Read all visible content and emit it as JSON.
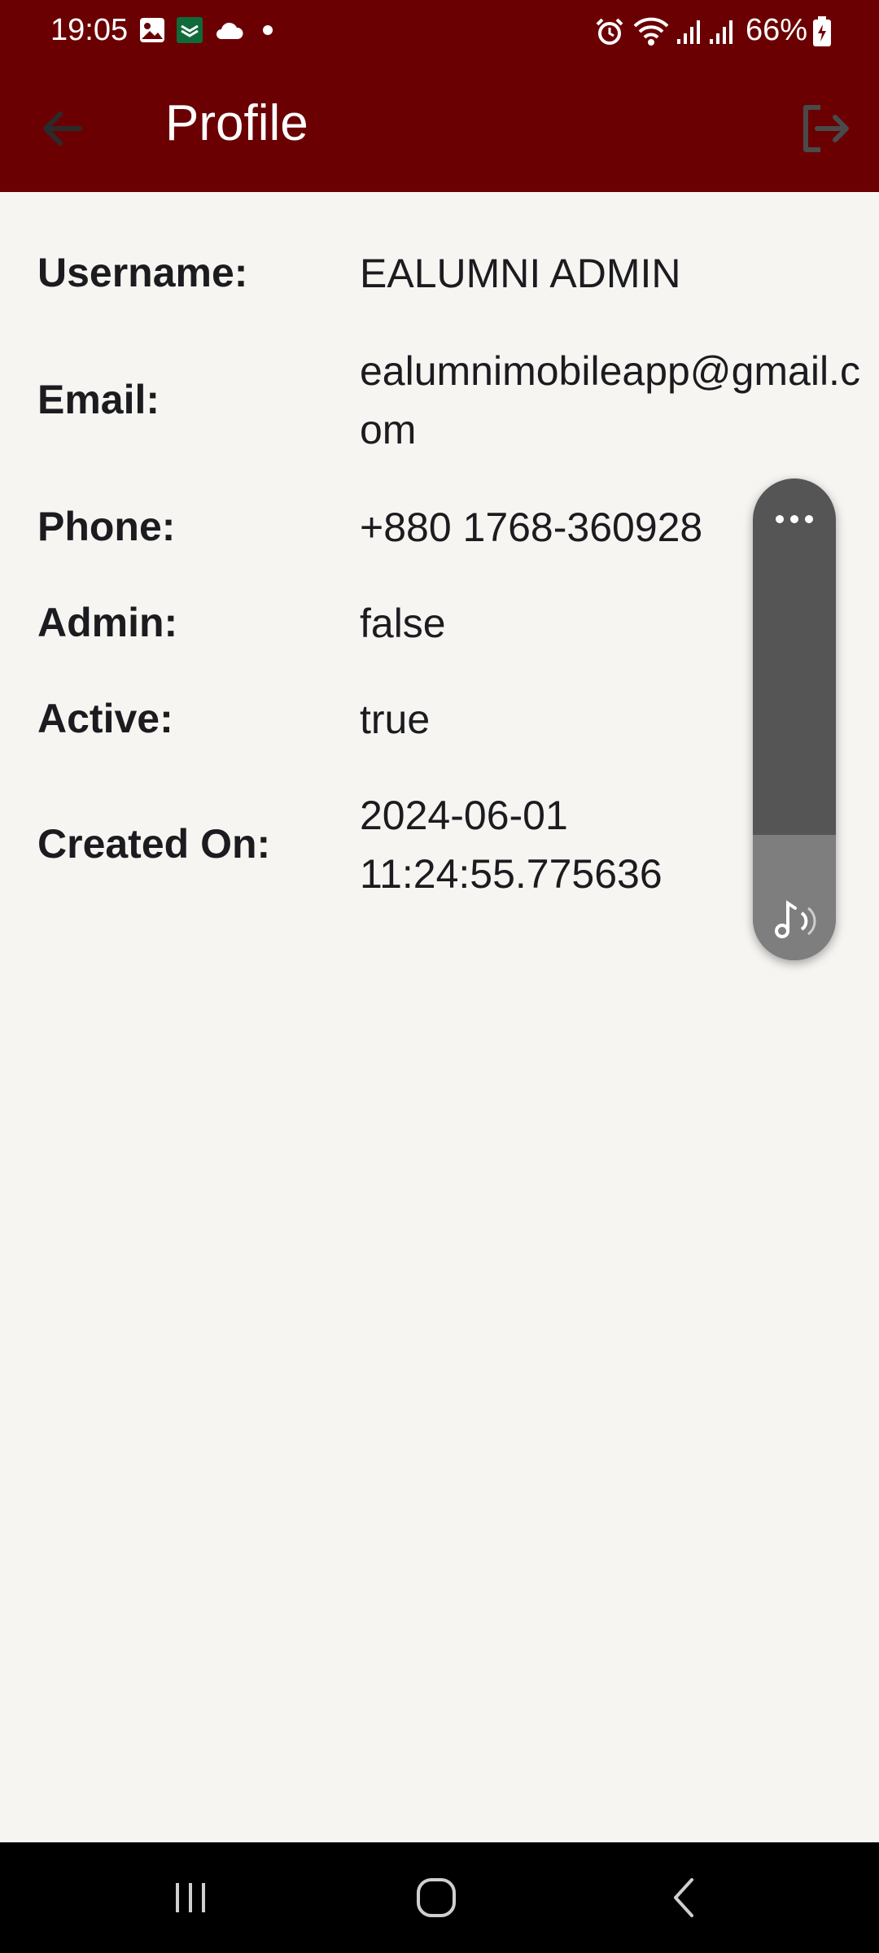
{
  "status_bar": {
    "time": "19:05",
    "battery": "66%",
    "icons": [
      "gallery-icon",
      "app-icon",
      "cloud-icon",
      "dot-icon",
      "alarm-icon",
      "wifi-icon",
      "signal-icon",
      "signal-icon",
      "battery-icon"
    ]
  },
  "app_bar": {
    "title": "Profile",
    "back_icon": "arrow-left-icon",
    "logout_icon": "logout-icon"
  },
  "profile": {
    "username_label": "Username:",
    "username_value": "EALUMNI ADMIN",
    "email_label": "Email:",
    "email_value": "ealumnimobileapp@gmail.com",
    "phone_label": "Phone:",
    "phone_value": "+880 1768-360928",
    "admin_label": "Admin:",
    "admin_value": "false",
    "active_label": "Active:",
    "active_value": "true",
    "created_label": "Created On:",
    "created_value": "2024-06-01 11:24:55.775636"
  },
  "volume_widget": {
    "level_fraction": 0.26,
    "more_icon": "more-horizontal-icon",
    "stream_icon": "music-note-icon"
  },
  "colors": {
    "app_bar": "#6b0003",
    "background": "#f6f5f2",
    "text": "#1c1b1f"
  }
}
